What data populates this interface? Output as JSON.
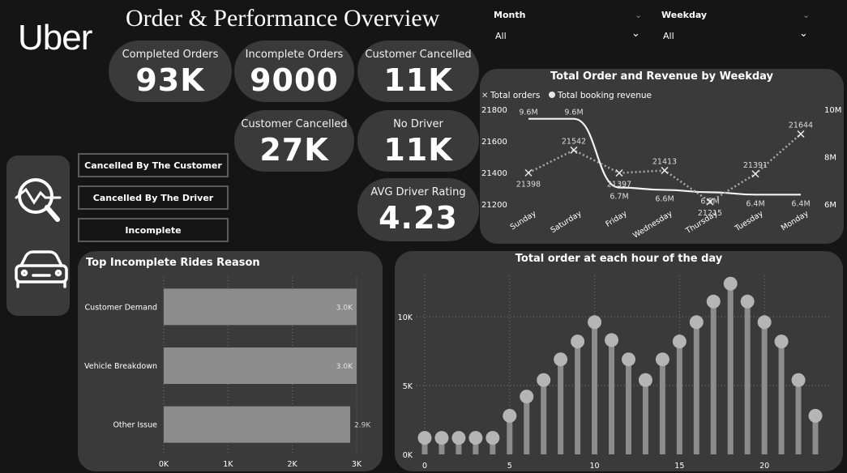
{
  "brand": {
    "logo": "Uber"
  },
  "page": {
    "title": "Order & Performance Overview"
  },
  "slicers": [
    {
      "title": "Month",
      "value": "All"
    },
    {
      "title": "Weekday",
      "value": "All"
    }
  ],
  "kpis": [
    {
      "label": "Completed Orders",
      "value": "93K"
    },
    {
      "label": "Incomplete Orders",
      "value": "9000"
    },
    {
      "label": "Customer Cancelled",
      "value": "11K"
    },
    {
      "label": "Customer Cancelled",
      "value": "27K"
    },
    {
      "label": "No Driver",
      "value": "11K"
    },
    {
      "label": "AVG Driver Rating",
      "value": "4.23"
    }
  ],
  "buttons": [
    {
      "label": "Cancelled By The Customer"
    },
    {
      "label": "Cancelled By The Driver"
    },
    {
      "label": "Incomplete"
    }
  ],
  "nav": {
    "icons": [
      "analytics-search-icon",
      "car-icon"
    ]
  },
  "colors": {
    "background": "#151515",
    "panel": "#3a3a3a",
    "bar": "#8c8c8c",
    "line_orders": "#aaaaaa",
    "line_revenue": "#ffffff"
  },
  "chart_data": [
    {
      "type": "line",
      "title": "Total Order and Revenue by Weekday",
      "categories": [
        "Sunday",
        "Saturday",
        "Friday",
        "Wednesday",
        "Thursday",
        "Tuesday",
        "Monday"
      ],
      "series": [
        {
          "name": "Total orders",
          "values": [
            21398,
            21542,
            21397,
            21413,
            21215,
            21391,
            21644
          ],
          "labels": [
            "21398",
            "21542",
            "21397",
            "21413",
            "21215",
            "21391",
            "21644"
          ],
          "axis": "left"
        },
        {
          "name": "Total booking revenue",
          "values": [
            9.6,
            9.6,
            6.7,
            6.6,
            6.5,
            6.4,
            6.4
          ],
          "labels": [
            "9.6M",
            "9.6M",
            "6.7M",
            "6.6M",
            "6.5M",
            "6.4M",
            "6.4M"
          ],
          "axis": "right"
        }
      ],
      "ylim": [
        21200,
        21800
      ],
      "yticks": [
        "21800",
        "21600",
        "21400",
        "21200"
      ],
      "y2lim": [
        6,
        10
      ],
      "y2ticks": [
        "10M",
        "8M",
        "6M"
      ],
      "legend": "top-left",
      "grid": false
    },
    {
      "type": "bar",
      "orientation": "horizontal",
      "title": "Top Incomplete Rides Reason",
      "categories": [
        "Customer Demand",
        "Vehicle Breakdown",
        "Other Issue"
      ],
      "values": [
        3.0,
        3.0,
        2.9
      ],
      "labels": [
        "3.0K",
        "3.0K",
        "2.9K"
      ],
      "xlim": [
        0,
        3
      ],
      "xticks": [
        "0K",
        "1K",
        "2K",
        "3K"
      ],
      "grid": true
    },
    {
      "type": "bar",
      "subtype": "lollipop",
      "title": "Total order at each hour of the day",
      "x": [
        0,
        1,
        2,
        3,
        4,
        5,
        6,
        7,
        8,
        9,
        10,
        11,
        12,
        13,
        14,
        15,
        16,
        17,
        18,
        19,
        20,
        21,
        22,
        23
      ],
      "values": [
        1.2,
        1.2,
        1.2,
        1.2,
        1.2,
        2.8,
        4.2,
        5.4,
        6.9,
        8.2,
        9.6,
        8.3,
        6.9,
        5.4,
        6.9,
        8.2,
        9.6,
        11.1,
        12.4,
        11.1,
        9.6,
        8.2,
        5.4,
        2.8
      ],
      "xticks": [
        "0",
        "5",
        "10",
        "15",
        "20"
      ],
      "yticks": [
        "0K",
        "5K",
        "10K"
      ],
      "ylim": [
        0,
        13
      ],
      "grid": true
    }
  ]
}
